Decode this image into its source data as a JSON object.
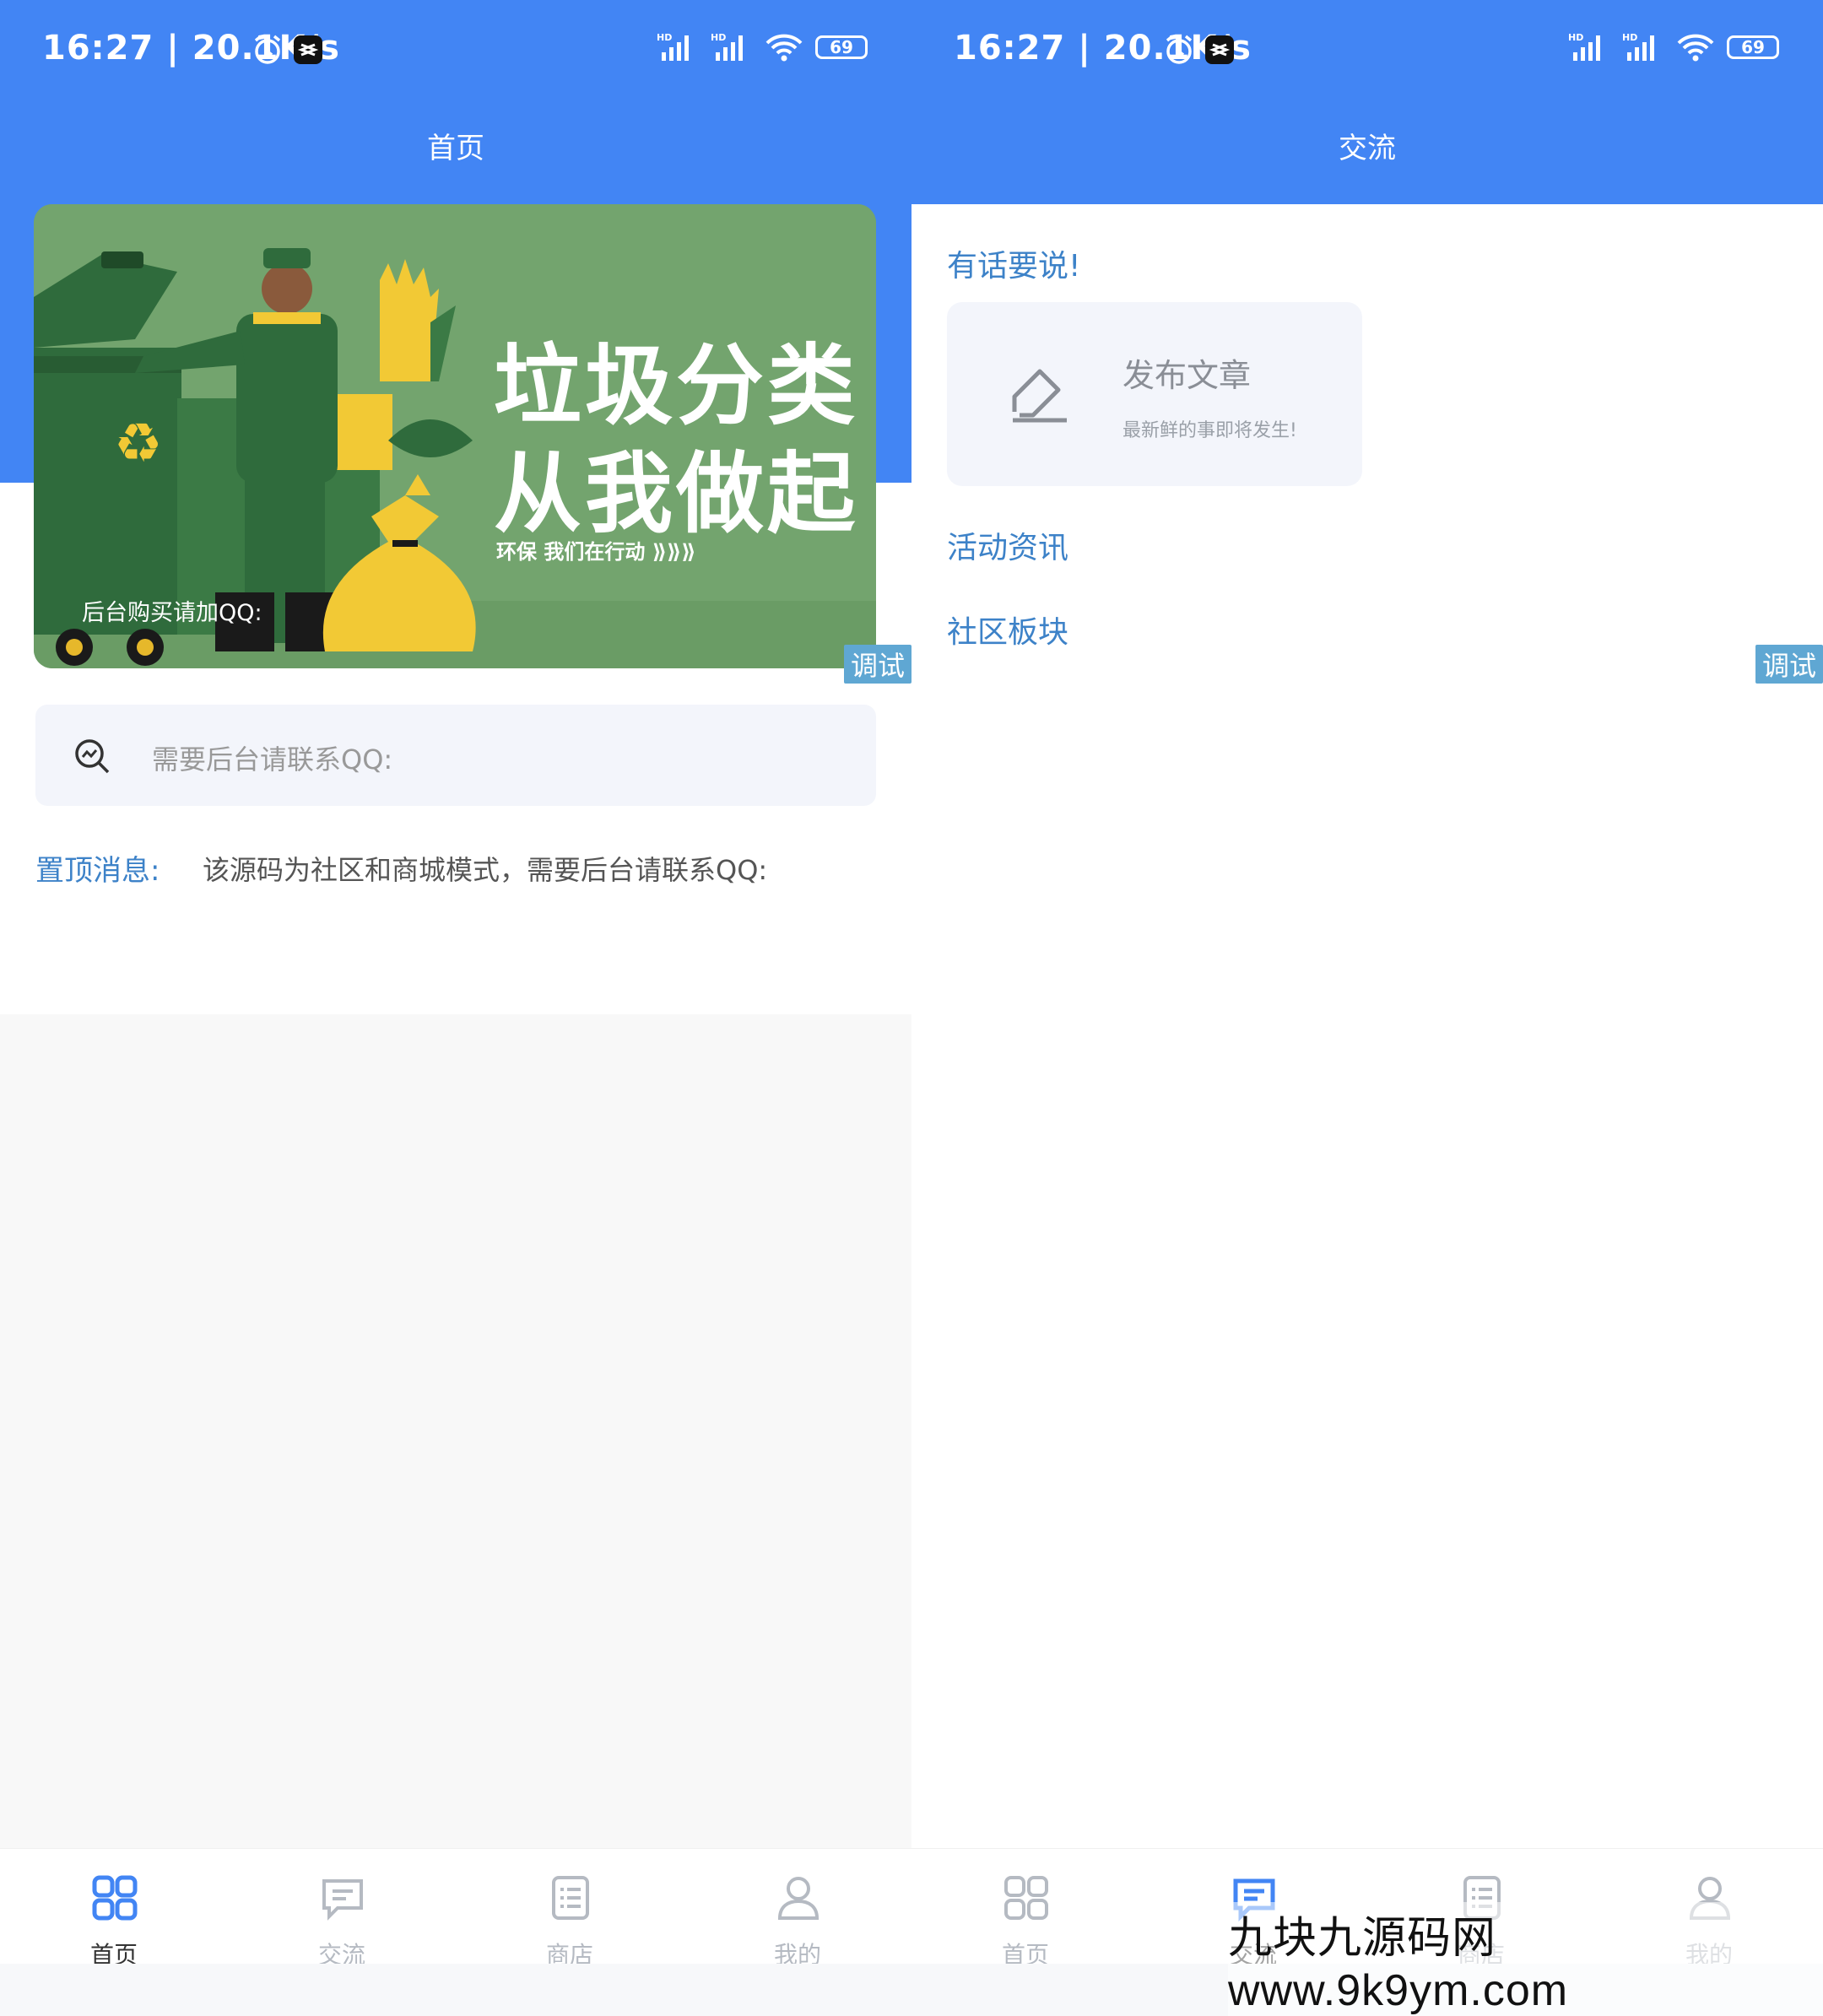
{
  "status_bar": {
    "time": "16:27 | 20.1K/s",
    "signal1": "HD",
    "signal2": "HD",
    "battery": "69"
  },
  "left_screen": {
    "header_title": "首页",
    "banner": {
      "title_line1": "垃圾分类",
      "title_line2": "从我做起",
      "subtitle": "环保  我们在行动  ⟫⟫⟫",
      "caption": "后台购买请加QQ:"
    },
    "debug_badge": "调试",
    "search": {
      "placeholder": "需要后台请联系QQ:"
    },
    "notice": {
      "label": "置顶消息:",
      "text": "该源码为社区和商城模式，需要后台请联系QQ:"
    }
  },
  "right_screen": {
    "header_title": "交流",
    "debug_badge": "调试",
    "section_speak": "有话要说!",
    "publish": {
      "title": "发布文章",
      "subtitle": "最新鲜的事即将发生!"
    },
    "section_activity": "活动资讯",
    "section_community": "社区板块"
  },
  "tabbar": [
    {
      "label": "首页",
      "icon": "grid-icon"
    },
    {
      "label": "交流",
      "icon": "chat-icon"
    },
    {
      "label": "商店",
      "icon": "list-icon"
    },
    {
      "label": "我的",
      "icon": "user-icon"
    }
  ],
  "colors": {
    "primary": "#4285f4",
    "accent_text": "#3d82c8",
    "banner_green": "#73a46e"
  },
  "watermark": "九块九源码网 www.9k9ym.com"
}
